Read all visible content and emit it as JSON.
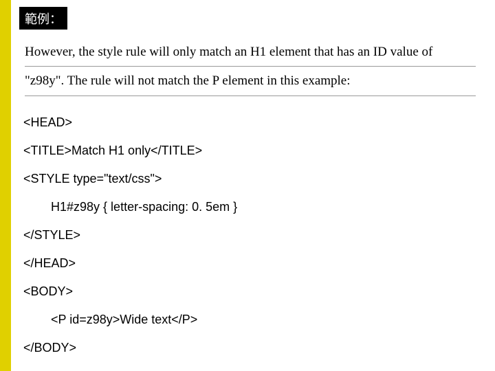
{
  "badge": "範例：",
  "description": {
    "line1": "However, the style rule will only match an H1 element that has an ID value of",
    "line2": "\"z98y\". The rule will not match the P element in this example:"
  },
  "code": {
    "l1": "<HEAD>",
    "l2": "<TITLE>Match H1 only</TITLE>",
    "l3": "<STYLE type=\"text/css\">",
    "l4": "  H1#z98y { letter-spacing: 0. 5em }",
    "l5": "</STYLE>",
    "l6": "</HEAD>",
    "l7": "<BODY>",
    "l8": "  <P id=z98y>Wide text</P>",
    "l9": "</BODY>"
  }
}
